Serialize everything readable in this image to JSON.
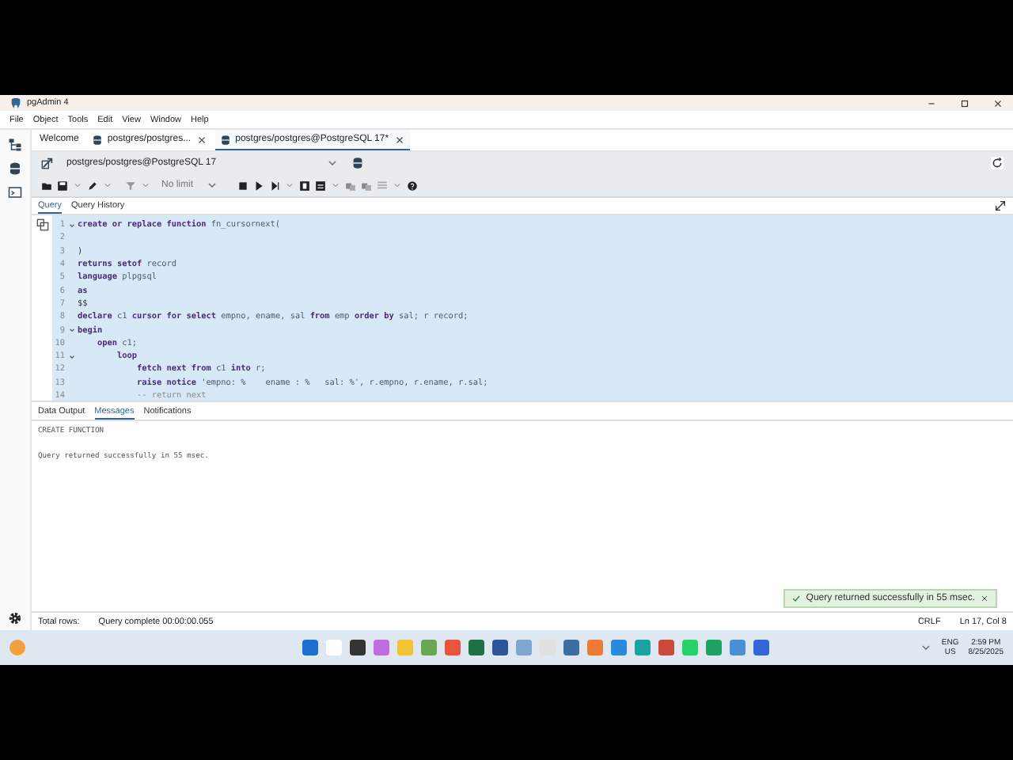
{
  "window": {
    "title": "pgAdmin 4"
  },
  "menu": [
    "File",
    "Object",
    "Tools",
    "Edit",
    "View",
    "Window",
    "Help"
  ],
  "tabs": [
    {
      "label": "Welcome",
      "kind": "plain",
      "selected": false
    },
    {
      "label": "postgres/postgres...",
      "kind": "query",
      "selected": false
    },
    {
      "label": "postgres/postgres@PostgreSQL 17*",
      "kind": "query",
      "selected": true
    }
  ],
  "connection": {
    "value": "postgres/postgres@PostgreSQL 17"
  },
  "toolbar": {
    "limit": "No limit"
  },
  "editor_tabs": [
    {
      "label": "Query",
      "selected": true
    },
    {
      "label": "Query History",
      "selected": false
    }
  ],
  "code": [
    {
      "number": "1",
      "fold": true,
      "tokens": [
        {
          "kind": "kw",
          "text": "create or replace function "
        },
        {
          "kind": "id",
          "text": "fn_cursornext("
        }
      ]
    },
    {
      "number": "2",
      "fold": false
    },
    {
      "number": "3",
      "fold": false,
      "tokens": [
        {
          "kind": "plain",
          "text": ")"
        }
      ]
    },
    {
      "number": "4",
      "fold": false,
      "tokens": [
        {
          "kind": "kw",
          "text": "returns setof "
        },
        {
          "kind": "id",
          "text": "record"
        }
      ]
    },
    {
      "number": "5",
      "fold": false,
      "tokens": [
        {
          "kind": "kw",
          "text": "language "
        },
        {
          "kind": "id",
          "text": "plpgsql"
        }
      ]
    },
    {
      "number": "6",
      "fold": false,
      "tokens": [
        {
          "kind": "kw",
          "text": "as"
        }
      ]
    },
    {
      "number": "7",
      "fold": false,
      "tokens": [
        {
          "kind": "plain",
          "text": "$$"
        }
      ]
    },
    {
      "number": "8",
      "fold": false,
      "tokens": [
        {
          "kind": "kw",
          "text": "declare "
        },
        {
          "kind": "id",
          "text": "c1 "
        },
        {
          "kind": "kw",
          "text": "cursor for select "
        },
        {
          "kind": "id",
          "text": "empno, ename, sal "
        },
        {
          "kind": "kw",
          "text": "from "
        },
        {
          "kind": "id",
          "text": "emp "
        },
        {
          "kind": "kw",
          "text": "order by "
        },
        {
          "kind": "id",
          "text": "sal; r record;"
        }
      ]
    },
    {
      "number": "9",
      "fold": true,
      "tokens": [
        {
          "kind": "kw",
          "text": "begin"
        }
      ]
    },
    {
      "number": "10",
      "fold": false,
      "tokens": [
        {
          "kind": "kw",
          "text": "    open "
        },
        {
          "kind": "id",
          "text": "c1;"
        }
      ]
    },
    {
      "number": "11",
      "fold": true,
      "tokens": [
        {
          "kind": "kw",
          "text": "        loop"
        }
      ]
    },
    {
      "number": "12",
      "fold": false,
      "tokens": [
        {
          "kind": "kw",
          "text": "            fetch next from "
        },
        {
          "kind": "id",
          "text": "c1 "
        },
        {
          "kind": "kw",
          "text": "into "
        },
        {
          "kind": "id",
          "text": "r;"
        }
      ]
    },
    {
      "number": "13",
      "fold": false,
      "tokens": [
        {
          "kind": "kw",
          "text": "            raise notice "
        },
        {
          "kind": "str",
          "text": "'empno: %    ename : %   sal: %'"
        },
        {
          "kind": "id",
          "text": ", r.empno, r.ename, r.sal;"
        }
      ]
    },
    {
      "number": "14",
      "fold": false,
      "tokens": [
        {
          "kind": "comment",
          "text": "            -- return next"
        }
      ]
    }
  ],
  "result_tabs": [
    {
      "label": "Data Output",
      "selected": false
    },
    {
      "label": "Messages",
      "selected": true
    },
    {
      "label": "Notifications",
      "selected": false
    }
  ],
  "messages": [
    "CREATE FUNCTION",
    "Query returned successfully in 55 msec."
  ],
  "status_bar": {
    "rows": "Total rows:",
    "query": "Query complete 00:00:00.055",
    "eol": "CRLF",
    "position": "Ln 17, Col 8"
  },
  "toast": {
    "text": "Query returned successfully in 55 msec."
  },
  "tray": {
    "language": "ENG",
    "region": "US",
    "time": "2:59 PM",
    "date": "8/25/2025"
  }
}
